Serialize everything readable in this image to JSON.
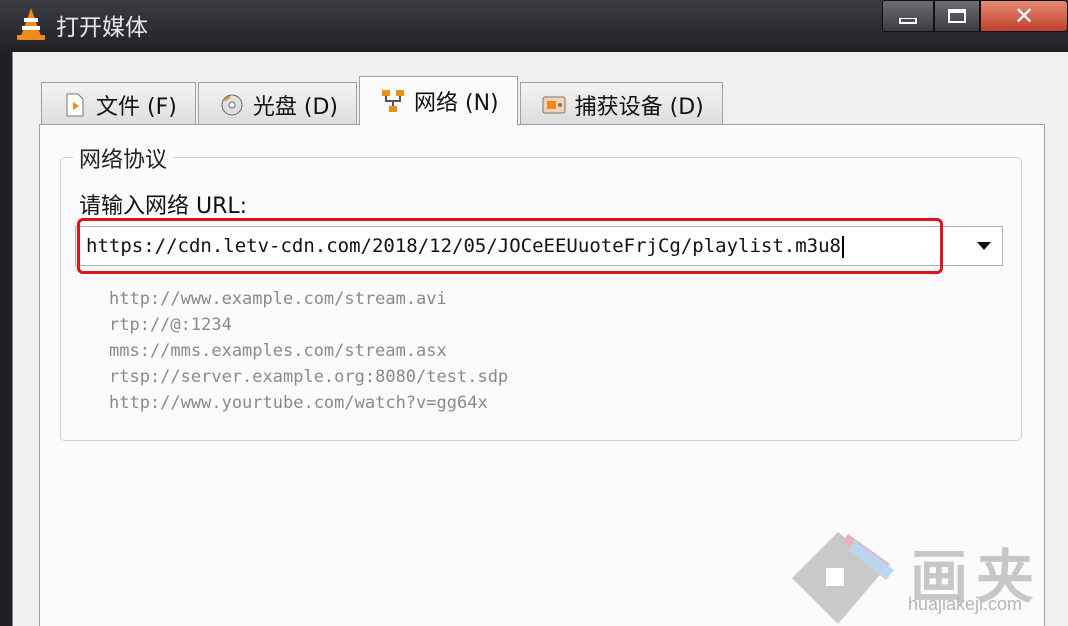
{
  "window": {
    "title": "打开媒体",
    "close_glyph": "✕"
  },
  "tabs": [
    {
      "label": "文件",
      "shortcut": "(F)",
      "icon": "file-icon"
    },
    {
      "label": "光盘",
      "shortcut": "(D)",
      "icon": "disc-icon"
    },
    {
      "label": "网络",
      "shortcut": "(N)",
      "icon": "network-icon",
      "active": true
    },
    {
      "label": "捕获设备",
      "shortcut": "(D)",
      "icon": "capture-device-icon"
    }
  ],
  "network_group": {
    "title": "网络协议",
    "url_label": "请输入网络 URL:",
    "url_value": "https://cdn.letv-cdn.com/2018/12/05/JOCeEEUuoteFrjCg/playlist.m3u8",
    "examples": [
      "http://www.example.com/stream.avi",
      "rtp://@:1234",
      "mms://mms.examples.com/stream.asx",
      "rtsp://server.example.org:8080/test.sdp",
      "http://www.yourtube.com/watch?v=gg64x"
    ]
  },
  "watermark": {
    "text": "画夹",
    "domain": "huajiakeji.com"
  },
  "colors": {
    "highlight": "#e0141b",
    "close_button": "#c2412a"
  }
}
